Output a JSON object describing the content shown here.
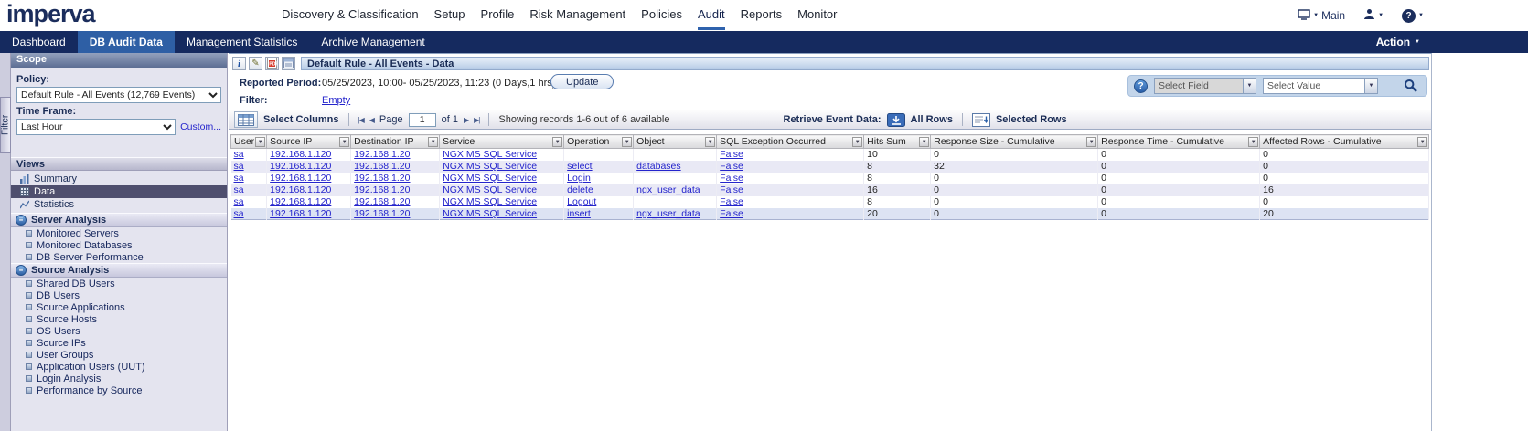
{
  "header": {
    "logo_text": "imperva",
    "nav_items": [
      {
        "label": "Discovery & Classification",
        "active": false
      },
      {
        "label": "Setup",
        "active": false
      },
      {
        "label": "Profile",
        "active": false
      },
      {
        "label": "Risk Management",
        "active": false
      },
      {
        "label": "Policies",
        "active": false
      },
      {
        "label": "Audit",
        "active": true
      },
      {
        "label": "Reports",
        "active": false
      },
      {
        "label": "Monitor",
        "active": false
      }
    ],
    "main_menu_label": "Main"
  },
  "tabbar": {
    "tabs": [
      {
        "label": "Dashboard",
        "active": false
      },
      {
        "label": "DB Audit Data",
        "active": true
      },
      {
        "label": "Management Statistics",
        "active": false
      },
      {
        "label": "Archive Management",
        "active": false
      }
    ],
    "action_label": "Action"
  },
  "sidebar": {
    "filter_tab_label": "Filter",
    "scope_title": "Scope",
    "policy_label": "Policy:",
    "policy_value": "Default Rule - All Events (12,769 Events)",
    "timeframe_label": "Time Frame:",
    "timeframe_value": "Last Hour",
    "custom_link": "Custom...",
    "views_title": "Views",
    "view_items": [
      {
        "label": "Summary",
        "icon": "summary",
        "selected": false
      },
      {
        "label": "Data",
        "icon": "data",
        "selected": true
      },
      {
        "label": "Statistics",
        "icon": "statistics",
        "selected": false
      }
    ],
    "sections": [
      {
        "title": "Server Analysis",
        "items": [
          "Monitored Servers",
          "Monitored Databases",
          "DB Server Performance"
        ]
      },
      {
        "title": "Source Analysis",
        "items": [
          "Shared DB Users",
          "DB Users",
          "Source Applications",
          "Source Hosts",
          "OS Users",
          "Source IPs",
          "User Groups",
          "Application Users (UUT)",
          "Login Analysis",
          "Performance by Source"
        ]
      }
    ]
  },
  "main": {
    "title": "Default Rule - All Events - Data",
    "reported_period_label": "Reported Period:",
    "reported_period_value": "05/25/2023, 10:00- 05/25/2023, 11:23 (0 Days,1 hrs)",
    "update_button_label": "Update",
    "filter_label": "Filter:",
    "filter_value": "Empty",
    "search": {
      "select_field_label": "Select Field",
      "select_value_label": "Select Value"
    },
    "toolbar": {
      "select_columns_label": "Select Columns",
      "page_label": "Page",
      "page_value": "1",
      "page_total_label": "of 1",
      "records_info": "Showing records 1-6 out of 6 available",
      "retrieve_label": "Retrieve Event Data:",
      "all_rows_label": "All Rows",
      "selected_rows_label": "Selected Rows"
    },
    "table": {
      "columns": [
        "User",
        "Source IP",
        "Destination IP",
        "Service",
        "Operation",
        "Object",
        "SQL Exception Occurred",
        "Hits Sum",
        "Response Size - Cumulative",
        "Response Time - Cumulative",
        "Affected Rows - Cumulative"
      ],
      "link_columns": [
        0,
        1,
        2,
        3,
        4,
        5,
        6
      ],
      "rows": [
        [
          "sa",
          "192.168.1.120",
          "192.168.1.20",
          "NGX MS SQL Service",
          "",
          "",
          "False",
          "10",
          "0",
          "0",
          "0"
        ],
        [
          "sa",
          "192.168.1.120",
          "192.168.1.20",
          "NGX MS SQL Service",
          "select",
          "databases",
          "False",
          "8",
          "32",
          "0",
          "0"
        ],
        [
          "sa",
          "192.168.1.120",
          "192.168.1.20",
          "NGX MS SQL Service",
          "Login",
          "",
          "False",
          "8",
          "0",
          "0",
          "0"
        ],
        [
          "sa",
          "192.168.1.120",
          "192.168.1.20",
          "NGX MS SQL Service",
          "delete",
          "ngx_user_data",
          "False",
          "16",
          "0",
          "0",
          "16"
        ],
        [
          "sa",
          "192.168.1.120",
          "192.168.1.20",
          "NGX MS SQL Service",
          "Logout",
          "",
          "False",
          "8",
          "0",
          "0",
          "0"
        ],
        [
          "sa",
          "192.168.1.120",
          "192.168.1.20",
          "NGX MS SQL Service",
          "insert",
          "ngx_user_data",
          "False",
          "20",
          "0",
          "0",
          "20"
        ]
      ]
    }
  },
  "colors": {
    "navy_bar": "#152a5f",
    "active_tab": "#2e5fa5",
    "link_blue": "#2424cc",
    "sidebar_bg": "#e4e4ef"
  }
}
